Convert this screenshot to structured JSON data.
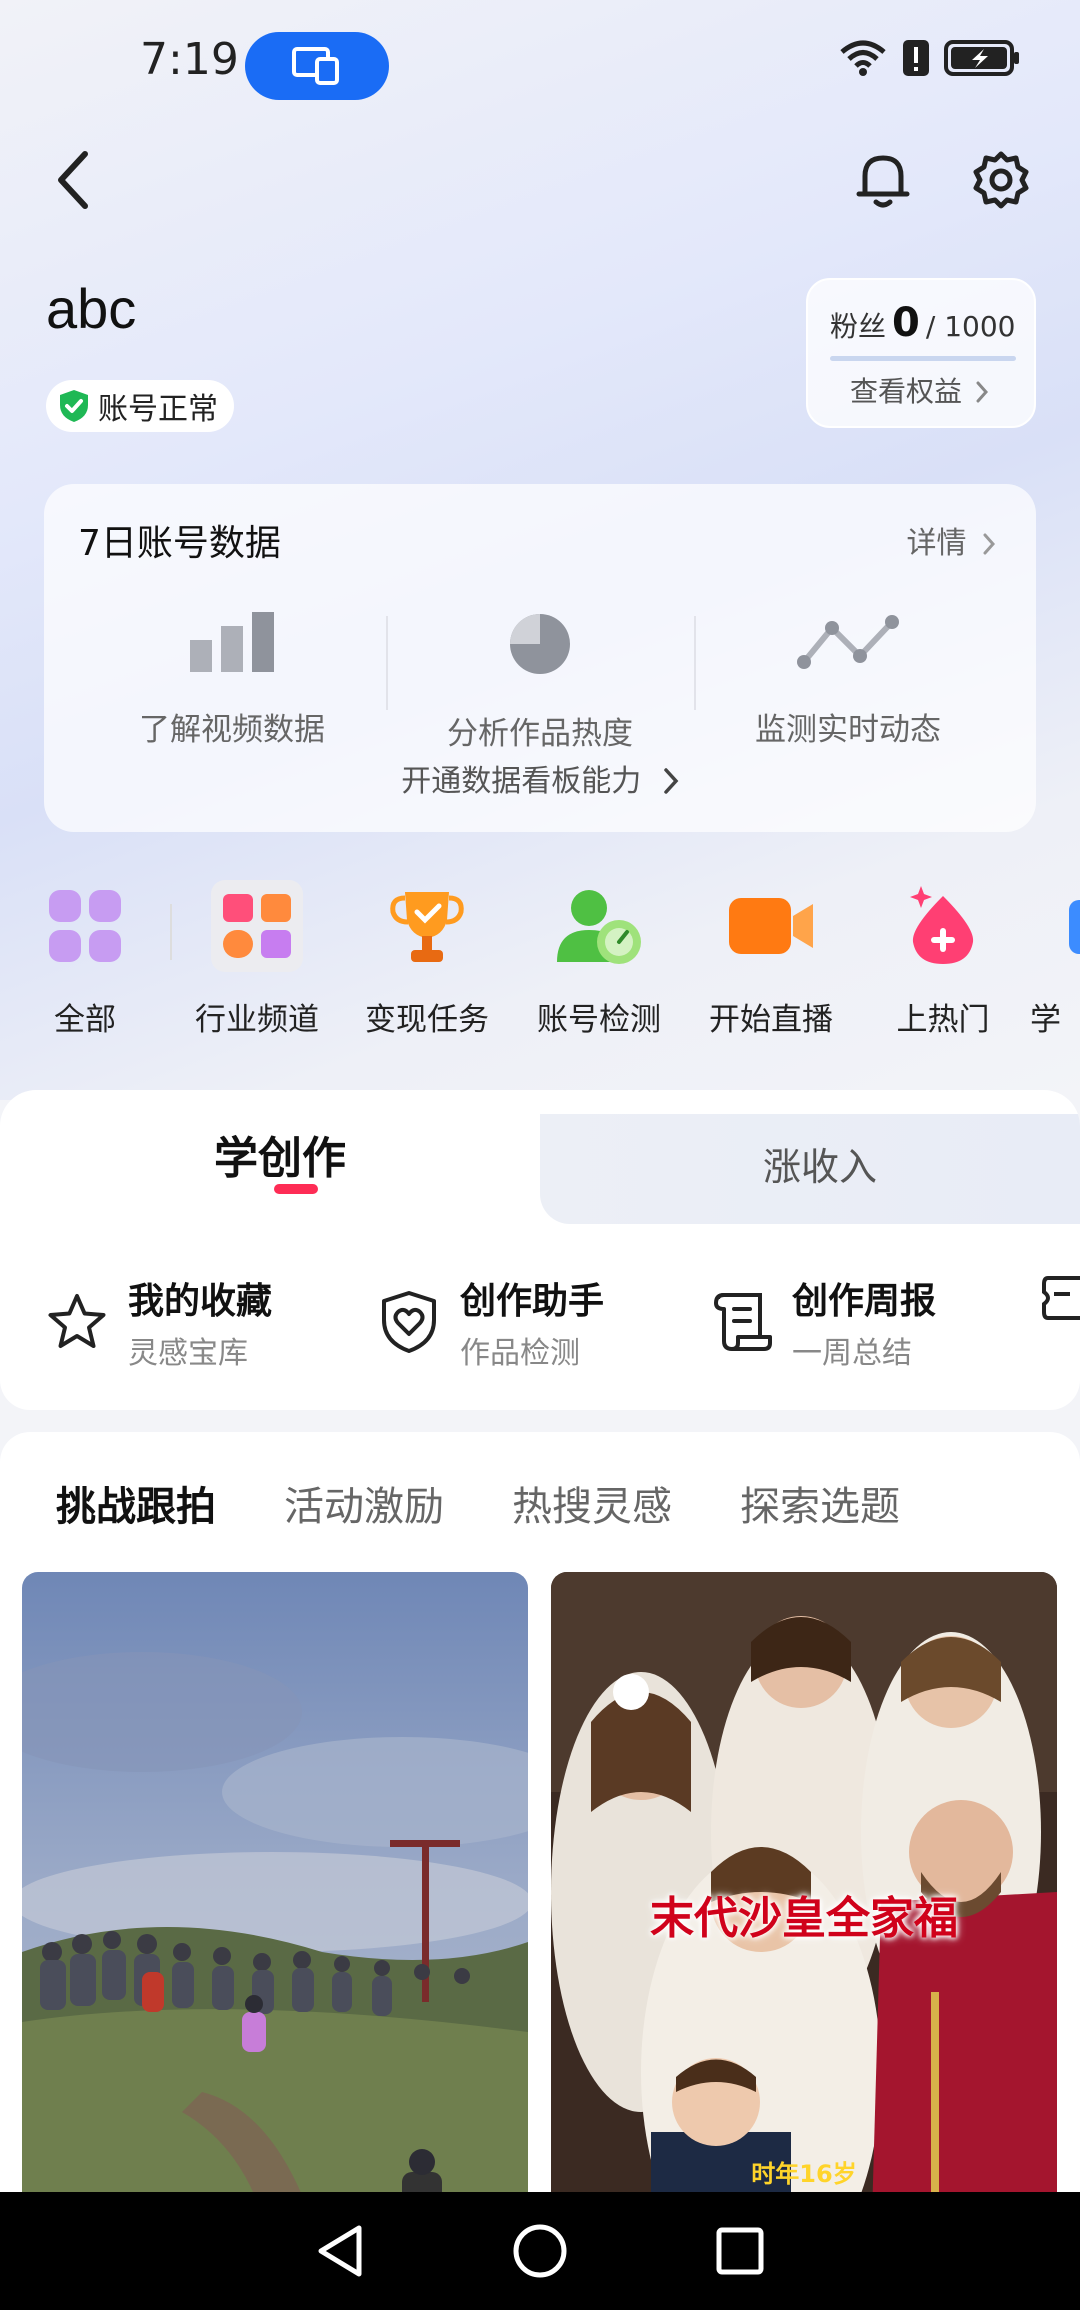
{
  "status_bar": {
    "time": "7:19"
  },
  "header": {
    "username": "abc",
    "account_status": "账号正常",
    "fans": {
      "label": "粉丝",
      "count": "0",
      "max": "/ 1000",
      "link": "查看权益"
    }
  },
  "data_card": {
    "title": "7日账号数据",
    "detail": "详情",
    "columns": [
      {
        "label": "了解视频数据",
        "icon": "bar-chart-icon"
      },
      {
        "label": "分析作品热度",
        "icon": "pie-chart-icon"
      },
      {
        "label": "监测实时动态",
        "icon": "line-chart-icon"
      }
    ],
    "unlock": "开通数据看板能力"
  },
  "quick_actions": [
    {
      "label": "全部",
      "icon": "grid-icon"
    },
    {
      "label": "行业频道",
      "icon": "channel-icon"
    },
    {
      "label": "变现任务",
      "icon": "trophy-icon"
    },
    {
      "label": "账号检测",
      "icon": "account-check-icon"
    },
    {
      "label": "开始直播",
      "icon": "camera-icon"
    },
    {
      "label": "上热门",
      "icon": "flame-icon"
    },
    {
      "label": "学",
      "icon": "learn-icon"
    }
  ],
  "learn": {
    "tab_active": "学创作",
    "tab_inactive": "涨收入",
    "tools": [
      {
        "title": "我的收藏",
        "sub": "灵感宝库",
        "icon": "star-icon"
      },
      {
        "title": "创作助手",
        "sub": "作品检测",
        "icon": "shield-heart-icon"
      },
      {
        "title": "创作周报",
        "sub": "一周总结",
        "icon": "report-icon"
      }
    ]
  },
  "challenge": {
    "tabs": [
      "挑战跟拍",
      "活动激励",
      "热搜灵感",
      "探索选题"
    ],
    "cards": [
      {
        "image": "crowd-on-hill-photo"
      },
      {
        "image": "royal-family-portrait",
        "caption": "末代沙皇全家福",
        "sub": "时年16岁"
      }
    ]
  },
  "colors": {
    "accent": "#fe2c55",
    "cast_pill": "#1a6cf5",
    "verified_green": "#1fb855"
  }
}
